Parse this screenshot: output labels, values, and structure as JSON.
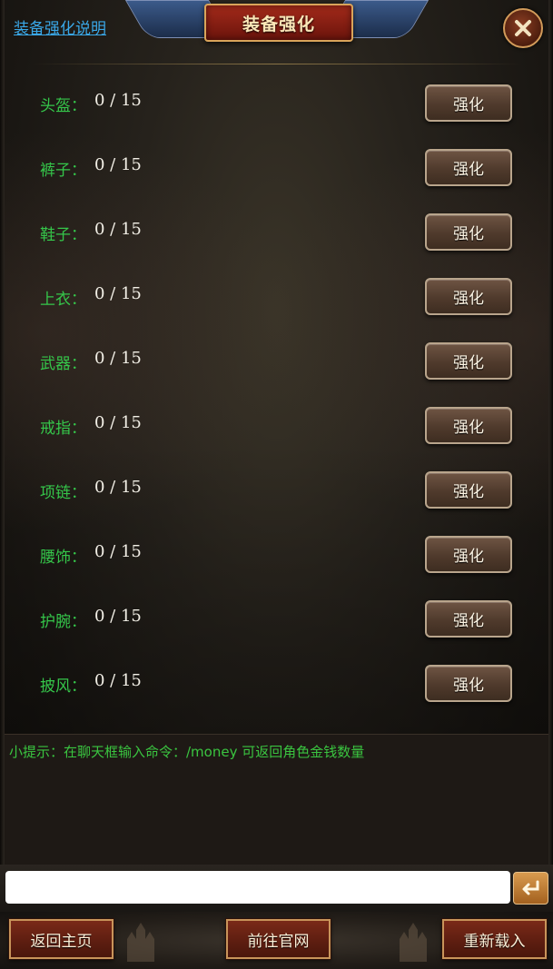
{
  "header": {
    "help_link": "装备强化说明",
    "title": "装备强化"
  },
  "rows": [
    {
      "label": "头盔：",
      "value": "0 / 15",
      "button": "强化"
    },
    {
      "label": "裤子：",
      "value": "0 / 15",
      "button": "强化"
    },
    {
      "label": "鞋子：",
      "value": "0 / 15",
      "button": "强化"
    },
    {
      "label": "上衣：",
      "value": "0 / 15",
      "button": "强化"
    },
    {
      "label": "武器：",
      "value": "0 / 15",
      "button": "强化"
    },
    {
      "label": "戒指：",
      "value": "0 / 15",
      "button": "强化"
    },
    {
      "label": "项链：",
      "value": "0 / 15",
      "button": "强化"
    },
    {
      "label": "腰饰：",
      "value": "0 / 15",
      "button": "强化"
    },
    {
      "label": "护腕：",
      "value": "0 / 15",
      "button": "强化"
    },
    {
      "label": "披风：",
      "value": "0 / 15",
      "button": "强化"
    }
  ],
  "tip": "小提示：在聊天框输入命令：/money 可返回角色金钱数量",
  "chat": {
    "value": "",
    "placeholder": ""
  },
  "bottom": {
    "home": "返回主页",
    "website": "前往官网",
    "reload": "重新载入"
  },
  "colors": {
    "label_green": "#35c64a",
    "tip_green": "#3ac440",
    "link_blue": "#3aa8e8",
    "title_red": "#a32a1a",
    "gold_border": "#d9a45a"
  },
  "icons": {
    "close": "close-icon",
    "enter": "enter-return-icon"
  }
}
